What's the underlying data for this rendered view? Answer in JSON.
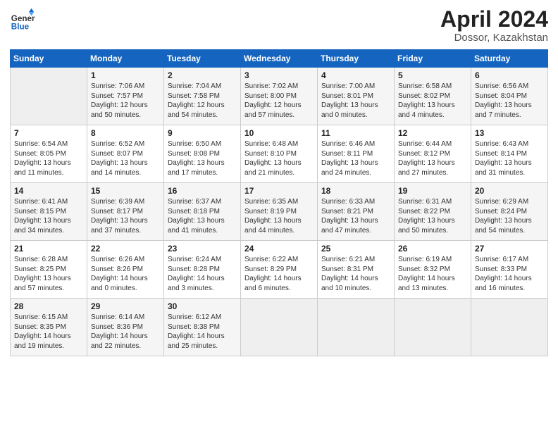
{
  "header": {
    "logo_general": "General",
    "logo_blue": "Blue",
    "month_title": "April 2024",
    "location": "Dossor, Kazakhstan"
  },
  "weekdays": [
    "Sunday",
    "Monday",
    "Tuesday",
    "Wednesday",
    "Thursday",
    "Friday",
    "Saturday"
  ],
  "weeks": [
    [
      {
        "day": "",
        "info": ""
      },
      {
        "day": "1",
        "info": "Sunrise: 7:06 AM\nSunset: 7:57 PM\nDaylight: 12 hours\nand 50 minutes."
      },
      {
        "day": "2",
        "info": "Sunrise: 7:04 AM\nSunset: 7:58 PM\nDaylight: 12 hours\nand 54 minutes."
      },
      {
        "day": "3",
        "info": "Sunrise: 7:02 AM\nSunset: 8:00 PM\nDaylight: 12 hours\nand 57 minutes."
      },
      {
        "day": "4",
        "info": "Sunrise: 7:00 AM\nSunset: 8:01 PM\nDaylight: 13 hours\nand 0 minutes."
      },
      {
        "day": "5",
        "info": "Sunrise: 6:58 AM\nSunset: 8:02 PM\nDaylight: 13 hours\nand 4 minutes."
      },
      {
        "day": "6",
        "info": "Sunrise: 6:56 AM\nSunset: 8:04 PM\nDaylight: 13 hours\nand 7 minutes."
      }
    ],
    [
      {
        "day": "7",
        "info": "Sunrise: 6:54 AM\nSunset: 8:05 PM\nDaylight: 13 hours\nand 11 minutes."
      },
      {
        "day": "8",
        "info": "Sunrise: 6:52 AM\nSunset: 8:07 PM\nDaylight: 13 hours\nand 14 minutes."
      },
      {
        "day": "9",
        "info": "Sunrise: 6:50 AM\nSunset: 8:08 PM\nDaylight: 13 hours\nand 17 minutes."
      },
      {
        "day": "10",
        "info": "Sunrise: 6:48 AM\nSunset: 8:10 PM\nDaylight: 13 hours\nand 21 minutes."
      },
      {
        "day": "11",
        "info": "Sunrise: 6:46 AM\nSunset: 8:11 PM\nDaylight: 13 hours\nand 24 minutes."
      },
      {
        "day": "12",
        "info": "Sunrise: 6:44 AM\nSunset: 8:12 PM\nDaylight: 13 hours\nand 27 minutes."
      },
      {
        "day": "13",
        "info": "Sunrise: 6:43 AM\nSunset: 8:14 PM\nDaylight: 13 hours\nand 31 minutes."
      }
    ],
    [
      {
        "day": "14",
        "info": "Sunrise: 6:41 AM\nSunset: 8:15 PM\nDaylight: 13 hours\nand 34 minutes."
      },
      {
        "day": "15",
        "info": "Sunrise: 6:39 AM\nSunset: 8:17 PM\nDaylight: 13 hours\nand 37 minutes."
      },
      {
        "day": "16",
        "info": "Sunrise: 6:37 AM\nSunset: 8:18 PM\nDaylight: 13 hours\nand 41 minutes."
      },
      {
        "day": "17",
        "info": "Sunrise: 6:35 AM\nSunset: 8:19 PM\nDaylight: 13 hours\nand 44 minutes."
      },
      {
        "day": "18",
        "info": "Sunrise: 6:33 AM\nSunset: 8:21 PM\nDaylight: 13 hours\nand 47 minutes."
      },
      {
        "day": "19",
        "info": "Sunrise: 6:31 AM\nSunset: 8:22 PM\nDaylight: 13 hours\nand 50 minutes."
      },
      {
        "day": "20",
        "info": "Sunrise: 6:29 AM\nSunset: 8:24 PM\nDaylight: 13 hours\nand 54 minutes."
      }
    ],
    [
      {
        "day": "21",
        "info": "Sunrise: 6:28 AM\nSunset: 8:25 PM\nDaylight: 13 hours\nand 57 minutes."
      },
      {
        "day": "22",
        "info": "Sunrise: 6:26 AM\nSunset: 8:26 PM\nDaylight: 14 hours\nand 0 minutes."
      },
      {
        "day": "23",
        "info": "Sunrise: 6:24 AM\nSunset: 8:28 PM\nDaylight: 14 hours\nand 3 minutes."
      },
      {
        "day": "24",
        "info": "Sunrise: 6:22 AM\nSunset: 8:29 PM\nDaylight: 14 hours\nand 6 minutes."
      },
      {
        "day": "25",
        "info": "Sunrise: 6:21 AM\nSunset: 8:31 PM\nDaylight: 14 hours\nand 10 minutes."
      },
      {
        "day": "26",
        "info": "Sunrise: 6:19 AM\nSunset: 8:32 PM\nDaylight: 14 hours\nand 13 minutes."
      },
      {
        "day": "27",
        "info": "Sunrise: 6:17 AM\nSunset: 8:33 PM\nDaylight: 14 hours\nand 16 minutes."
      }
    ],
    [
      {
        "day": "28",
        "info": "Sunrise: 6:15 AM\nSunset: 8:35 PM\nDaylight: 14 hours\nand 19 minutes."
      },
      {
        "day": "29",
        "info": "Sunrise: 6:14 AM\nSunset: 8:36 PM\nDaylight: 14 hours\nand 22 minutes."
      },
      {
        "day": "30",
        "info": "Sunrise: 6:12 AM\nSunset: 8:38 PM\nDaylight: 14 hours\nand 25 minutes."
      },
      {
        "day": "",
        "info": ""
      },
      {
        "day": "",
        "info": ""
      },
      {
        "day": "",
        "info": ""
      },
      {
        "day": "",
        "info": ""
      }
    ]
  ]
}
